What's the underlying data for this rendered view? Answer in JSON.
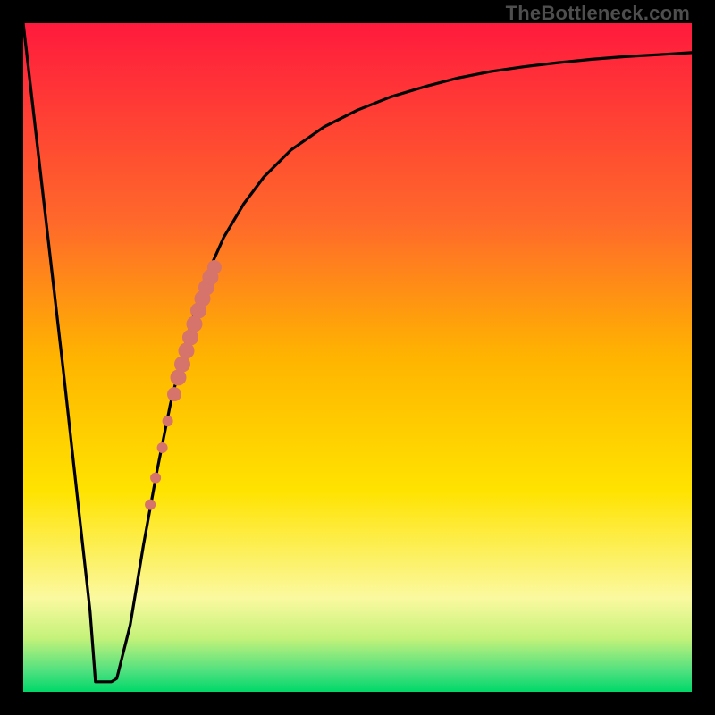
{
  "watermark": "TheBottleneck.com",
  "colors": {
    "frame": "#000000",
    "curve": "#000000",
    "dot_fill": "#d6736b",
    "dot_stroke": "#b85a52",
    "gradient_top": "#ff1a3d",
    "gradient_mid1": "#ff8a2a",
    "gradient_mid2": "#ffd400",
    "gradient_mid3": "#fff99a",
    "gradient_mid4": "#c4f27a",
    "gradient_bottom": "#00e06a"
  },
  "chart_data": {
    "type": "line",
    "title": "",
    "xlabel": "",
    "ylabel": "",
    "xlim": [
      0,
      100
    ],
    "ylim": [
      0,
      100
    ],
    "series": [
      {
        "name": "curve",
        "x": [
          0,
          6,
          8,
          10,
          12,
          13,
          14,
          16,
          18,
          20,
          22,
          24,
          26,
          28,
          30,
          33,
          36,
          40,
          45,
          50,
          55,
          60,
          65,
          70,
          75,
          80,
          85,
          90,
          95,
          100
        ],
        "y": [
          100,
          48,
          30,
          12,
          2,
          1.5,
          2,
          10,
          22,
          33,
          43,
          51,
          58,
          63.5,
          68,
          73,
          77,
          81,
          84.5,
          87,
          89,
          90.5,
          91.8,
          92.8,
          93.5,
          94.1,
          94.6,
          95,
          95.3,
          95.6
        ]
      }
    ],
    "flat_bottom": {
      "x0": 10.8,
      "x1": 13.2,
      "y": 1.5
    },
    "dots": [
      {
        "x": 19.0,
        "y": 28.0,
        "r": 6
      },
      {
        "x": 19.8,
        "y": 32.0,
        "r": 6
      },
      {
        "x": 20.8,
        "y": 36.5,
        "r": 6
      },
      {
        "x": 21.6,
        "y": 40.5,
        "r": 6
      },
      {
        "x": 22.6,
        "y": 44.5,
        "r": 8
      },
      {
        "x": 23.2,
        "y": 47.0,
        "r": 9
      },
      {
        "x": 23.8,
        "y": 49.0,
        "r": 9
      },
      {
        "x": 24.4,
        "y": 51.0,
        "r": 9
      },
      {
        "x": 25.0,
        "y": 53.0,
        "r": 9
      },
      {
        "x": 25.6,
        "y": 55.0,
        "r": 9
      },
      {
        "x": 26.2,
        "y": 57.0,
        "r": 9
      },
      {
        "x": 26.8,
        "y": 58.8,
        "r": 9
      },
      {
        "x": 27.4,
        "y": 60.5,
        "r": 9
      },
      {
        "x": 28.0,
        "y": 62.0,
        "r": 9
      },
      {
        "x": 28.6,
        "y": 63.5,
        "r": 8
      }
    ],
    "background": {
      "type": "vertical-gradient",
      "stops": [
        {
          "pos": 0.0,
          "color": "#ff1a3d"
        },
        {
          "pos": 0.3,
          "color": "#ff6a2a"
        },
        {
          "pos": 0.5,
          "color": "#ffb400"
        },
        {
          "pos": 0.7,
          "color": "#ffe300"
        },
        {
          "pos": 0.86,
          "color": "#fbf9a0"
        },
        {
          "pos": 0.92,
          "color": "#c4f27a"
        },
        {
          "pos": 0.97,
          "color": "#4de07f"
        },
        {
          "pos": 1.0,
          "color": "#00d868"
        }
      ]
    }
  }
}
